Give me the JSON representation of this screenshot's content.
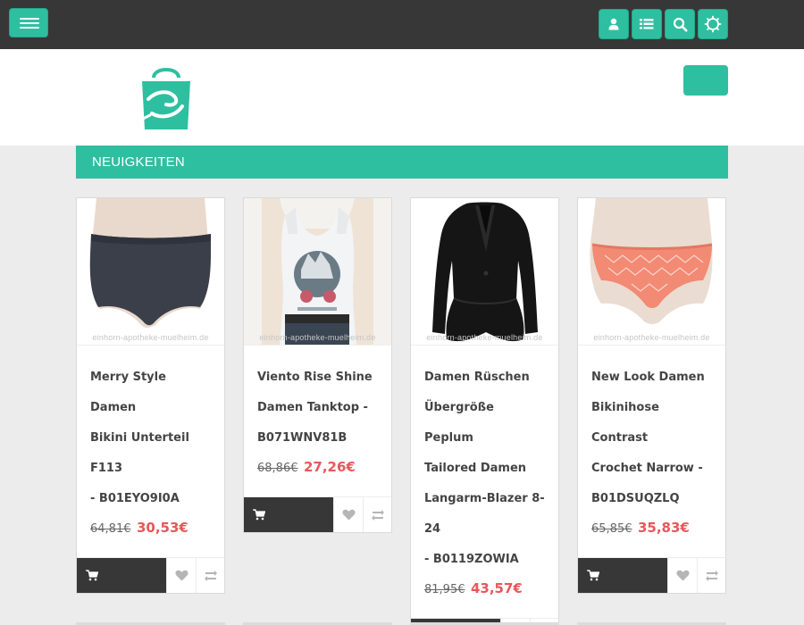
{
  "topbar": {
    "menu_icon": "hamburger-icon",
    "icons": [
      "user-icon",
      "list-icon",
      "search-icon",
      "settings-icon"
    ]
  },
  "header": {
    "logo_icon": "shopping-bag-hug-logo"
  },
  "section": {
    "title": "NEUIGKEITEN"
  },
  "watermark": "einhorn-apotheke-muelheim.de",
  "products": [
    {
      "title_lines": [
        "Merry Style Damen",
        "Bikini Unterteil F113",
        "- B01EYO9I0A"
      ],
      "old_price": "64,81€",
      "new_price": "30,53€"
    },
    {
      "title_lines": [
        "Viento Rise Shine",
        "Damen Tanktop -",
        "B071WNV81B"
      ],
      "old_price": "68,86€",
      "new_price": "27,26€"
    },
    {
      "title_lines": [
        "Damen Rüschen",
        "Übergröße Peplum",
        "Tailored Damen",
        "Langarm-Blazer 8-24",
        "- B0119ZOWIA"
      ],
      "old_price": "81,95€",
      "new_price": "43,57€"
    },
    {
      "title_lines": [
        "New Look Damen",
        "Bikinihose Contrast",
        "Crochet Narrow -",
        "B01DSUQZLQ"
      ],
      "old_price": "65,85€",
      "new_price": "35,83€"
    }
  ],
  "colors": {
    "accent": "#2ebfa0",
    "dark": "#373737",
    "price": "#e8575a"
  }
}
